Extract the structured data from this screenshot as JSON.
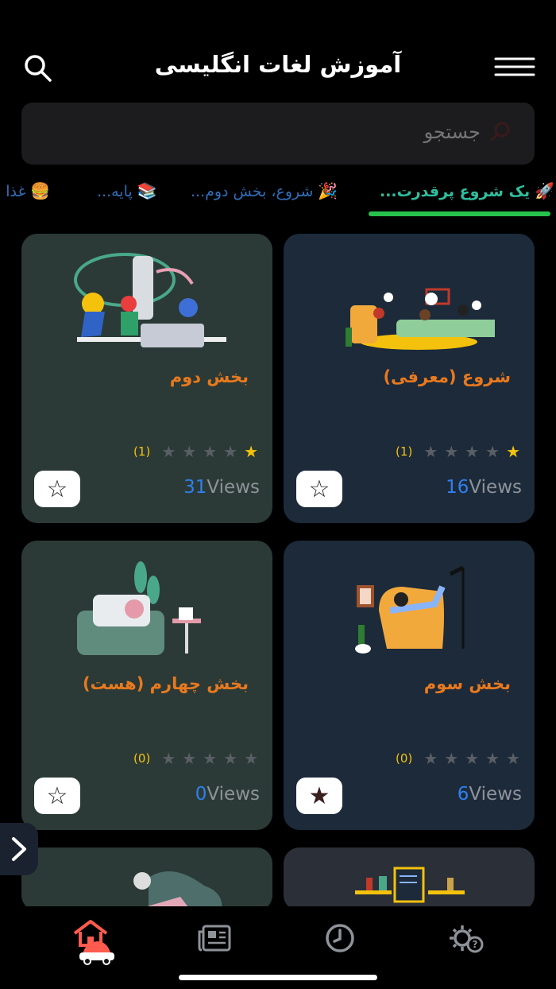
{
  "header": {
    "title": "آموزش لغات انگلیسی"
  },
  "search": {
    "placeholder": "جستجو"
  },
  "tabs": [
    {
      "emoji": "🚀",
      "label": "یک شروع پرقدرت..."
    },
    {
      "emoji": "🎉",
      "label": "شروع، بخش دوم..."
    },
    {
      "emoji": "📚",
      "label": "پایه..."
    },
    {
      "emoji": "🍔",
      "label": "غذا و"
    }
  ],
  "cards": [
    {
      "title": "بخش دوم",
      "rating_count": "(1)",
      "views": "31",
      "views_label": "Views",
      "stars_on": 1,
      "favorited": false
    },
    {
      "title": "شروع (معرفی)",
      "rating_count": "(1)",
      "views": "16",
      "views_label": "Views",
      "stars_on": 1,
      "favorited": false
    },
    {
      "title": "بخش چهارم (هست)",
      "rating_count": "(0)",
      "views": "0",
      "views_label": "Views",
      "stars_on": 0,
      "favorited": false
    },
    {
      "title": "بخش سوم",
      "rating_count": "(0)",
      "views": "6",
      "views_label": "Views",
      "stars_on": 0,
      "favorited": true
    }
  ],
  "colors": {
    "accent_orange": "#e8791e",
    "tab_active": "#27c24c",
    "views_blue": "#2f80ed",
    "star_gold": "#f4c20d"
  },
  "icons": [
    "search-icon",
    "menu-icon",
    "home-icon",
    "news-icon",
    "history-icon",
    "settings-help-icon",
    "chevron-right-icon",
    "star-icon"
  ]
}
